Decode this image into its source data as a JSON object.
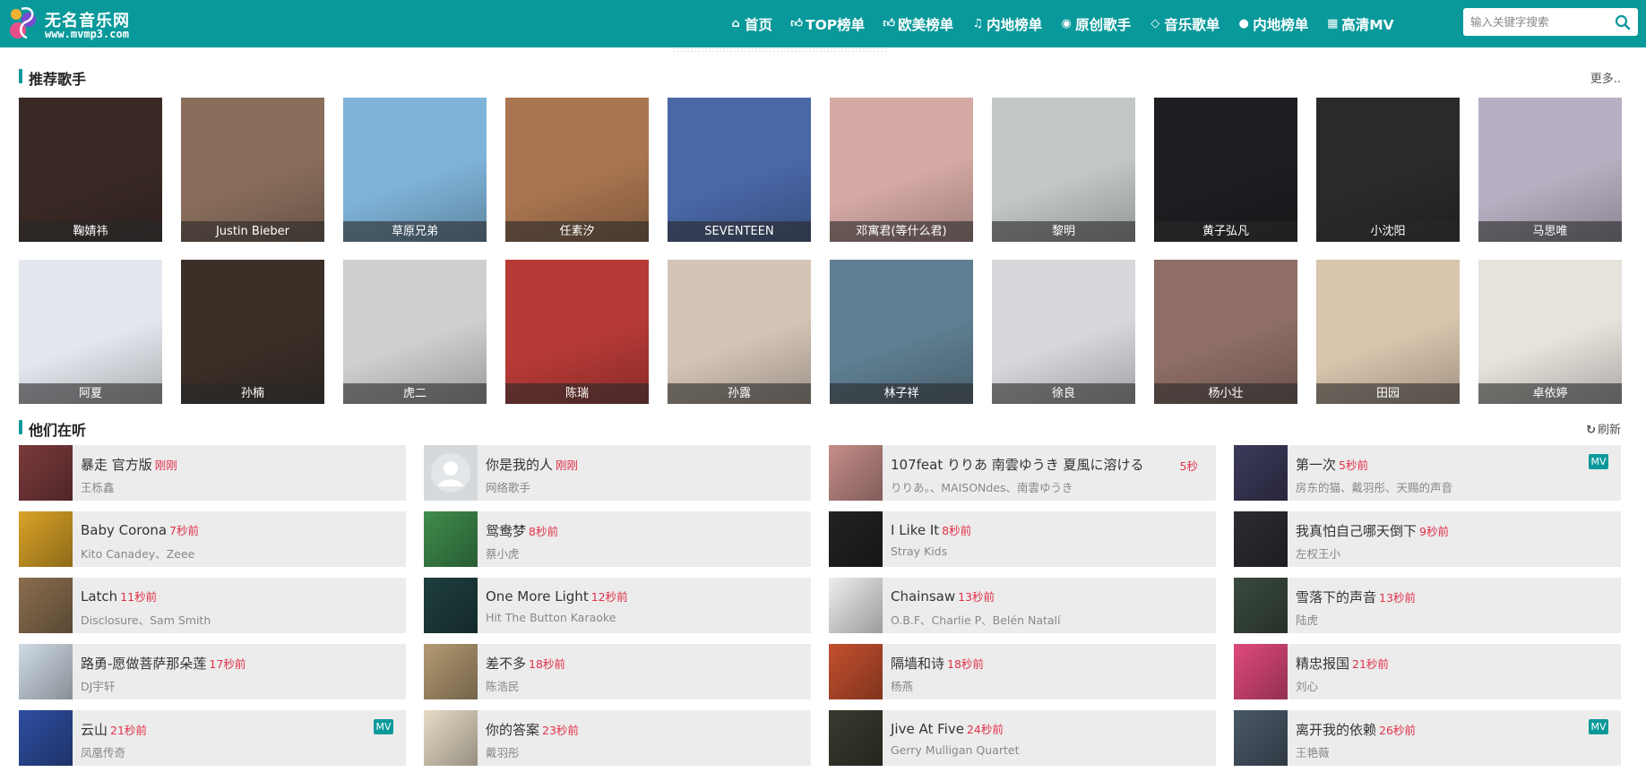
{
  "site": {
    "title": "无名音乐网",
    "subtitle": "www.mvmp3.com"
  },
  "nav": [
    {
      "label": "首页",
      "icon": "home-icon"
    },
    {
      "label": "TOP榜单",
      "icon": "thumbs-up-icon"
    },
    {
      "label": "欧美榜单",
      "icon": "thumbs-up-icon"
    },
    {
      "label": "内地榜单",
      "icon": "music-note-icon"
    },
    {
      "label": "原创歌手",
      "icon": "user-circle-icon"
    },
    {
      "label": "音乐歌单",
      "icon": "diamond-icon"
    },
    {
      "label": "内地榜单",
      "icon": "circle-icon"
    },
    {
      "label": "高清MV",
      "icon": "film-icon"
    }
  ],
  "search": {
    "placeholder": "输入关键字搜索"
  },
  "singers_section": {
    "title": "推荐歌手",
    "more": "更多.."
  },
  "singers": [
    {
      "name": "鞠婧祎",
      "color": "#3a2a26"
    },
    {
      "name": "Justin Bieber",
      "color": "#8a6e5c"
    },
    {
      "name": "草原兄弟",
      "color": "#7fb3d8"
    },
    {
      "name": "任素汐",
      "color": "#a97550"
    },
    {
      "name": "SEVENTEEN",
      "color": "#4a68a8"
    },
    {
      "name": "邓寓君(等什么君)",
      "color": "#d5a9a4"
    },
    {
      "name": "黎明",
      "color": "#c3c8c6"
    },
    {
      "name": "黄子弘凡",
      "color": "#1e1e22"
    },
    {
      "name": "小沈阳",
      "color": "#2a2a2a"
    },
    {
      "name": "马思唯",
      "color": "#b8b0c2"
    },
    {
      "name": "阿夏",
      "color": "#e4e8ee"
    },
    {
      "name": "孙楠",
      "color": "#3b3028"
    },
    {
      "name": "虎二",
      "color": "#cfcfcf"
    },
    {
      "name": "陈瑞",
      "color": "#b63a36"
    },
    {
      "name": "孙露",
      "color": "#d4c4b6"
    },
    {
      "name": "林子祥",
      "color": "#5f7f92"
    },
    {
      "name": "徐良",
      "color": "#d8d8dc"
    },
    {
      "name": "杨小壮",
      "color": "#8e6e66"
    },
    {
      "name": "田园",
      "color": "#d9c4ad"
    },
    {
      "name": "卓依婷",
      "color": "#e6e2dc"
    }
  ],
  "listening_section": {
    "title": "他们在听",
    "refresh": "刷新"
  },
  "songs": [
    {
      "title": "暴走 官方版",
      "time": "刚刚",
      "artist": "王栎鑫",
      "mv": "",
      "cover": "#7a3a3c"
    },
    {
      "title": "你是我的人",
      "time": "刚刚",
      "artist": "网络歌手",
      "mv": "",
      "cover": "#cfd3d6"
    },
    {
      "title": "107feat りりあ 南雲ゆうき 夏風に溶ける",
      "time": "5秒",
      "artist": "りりあ。、MAISONdes、南雲ゆうき",
      "mv": "",
      "cover": "#c68e8a"
    },
    {
      "title": "第一次",
      "time": "5秒前",
      "artist": "房东的猫、戴羽彤、天赐的声音",
      "mv": "MV",
      "cover": "#3c3a5a"
    },
    {
      "title": "Baby Corona",
      "time": "7秒前",
      "artist": "Kito Canadey、Zeee",
      "mv": "",
      "cover": "#d9a327"
    },
    {
      "title": "鸳鸯梦",
      "time": "8秒前",
      "artist": "蔡小虎",
      "mv": "",
      "cover": "#3f8d4d"
    },
    {
      "title": "I Like It",
      "time": "8秒前",
      "artist": "Stray Kids",
      "mv": "",
      "cover": "#222222"
    },
    {
      "title": "我真怕自己哪天倒下",
      "time": "9秒前",
      "artist": "左权王小",
      "mv": "",
      "cover": "#2c2c33"
    },
    {
      "title": "Latch",
      "time": "11秒前",
      "artist": "Disclosure、Sam Smith",
      "mv": "",
      "cover": "#8a6e4f"
    },
    {
      "title": "One More Light",
      "time": "12秒前",
      "artist": "Hit The Button Karaoke",
      "mv": "",
      "cover": "#1f3f3f"
    },
    {
      "title": "Chainsaw",
      "time": "13秒前",
      "artist": "O.B.F、Charlie P、Belén Natalí",
      "mv": "",
      "cover": "#eeeeee"
    },
    {
      "title": "雪落下的声音",
      "time": "13秒前",
      "artist": "陆虎",
      "mv": "",
      "cover": "#3a4a40"
    },
    {
      "title": "路勇-愿做菩萨那朵莲",
      "time": "17秒前",
      "artist": "DJ宇轩",
      "mv": "",
      "cover": "#d0dbe6"
    },
    {
      "title": "差不多",
      "time": "18秒前",
      "artist": "陈浩民",
      "mv": "",
      "cover": "#b39a72"
    },
    {
      "title": "隔墙和诗",
      "time": "18秒前",
      "artist": "杨燕",
      "mv": "",
      "cover": "#c4502e"
    },
    {
      "title": "精忠报国",
      "time": "21秒前",
      "artist": "刘心",
      "mv": "",
      "cover": "#e04a7a"
    },
    {
      "title": "云山",
      "time": "21秒前",
      "artist": "凤凰传奇",
      "mv": "MV",
      "cover": "#2e4ea0"
    },
    {
      "title": "你的答案",
      "time": "23秒前",
      "artist": "戴羽彤",
      "mv": "",
      "cover": "#e7dcc6"
    },
    {
      "title": "Jive At Five",
      "time": "24秒前",
      "artist": "Gerry Mulligan Quartet",
      "mv": "",
      "cover": "#3a3a30"
    },
    {
      "title": "离开我的依赖",
      "time": "26秒前",
      "artist": "王艳薇",
      "mv": "MV",
      "cover": "#4a5868"
    }
  ]
}
